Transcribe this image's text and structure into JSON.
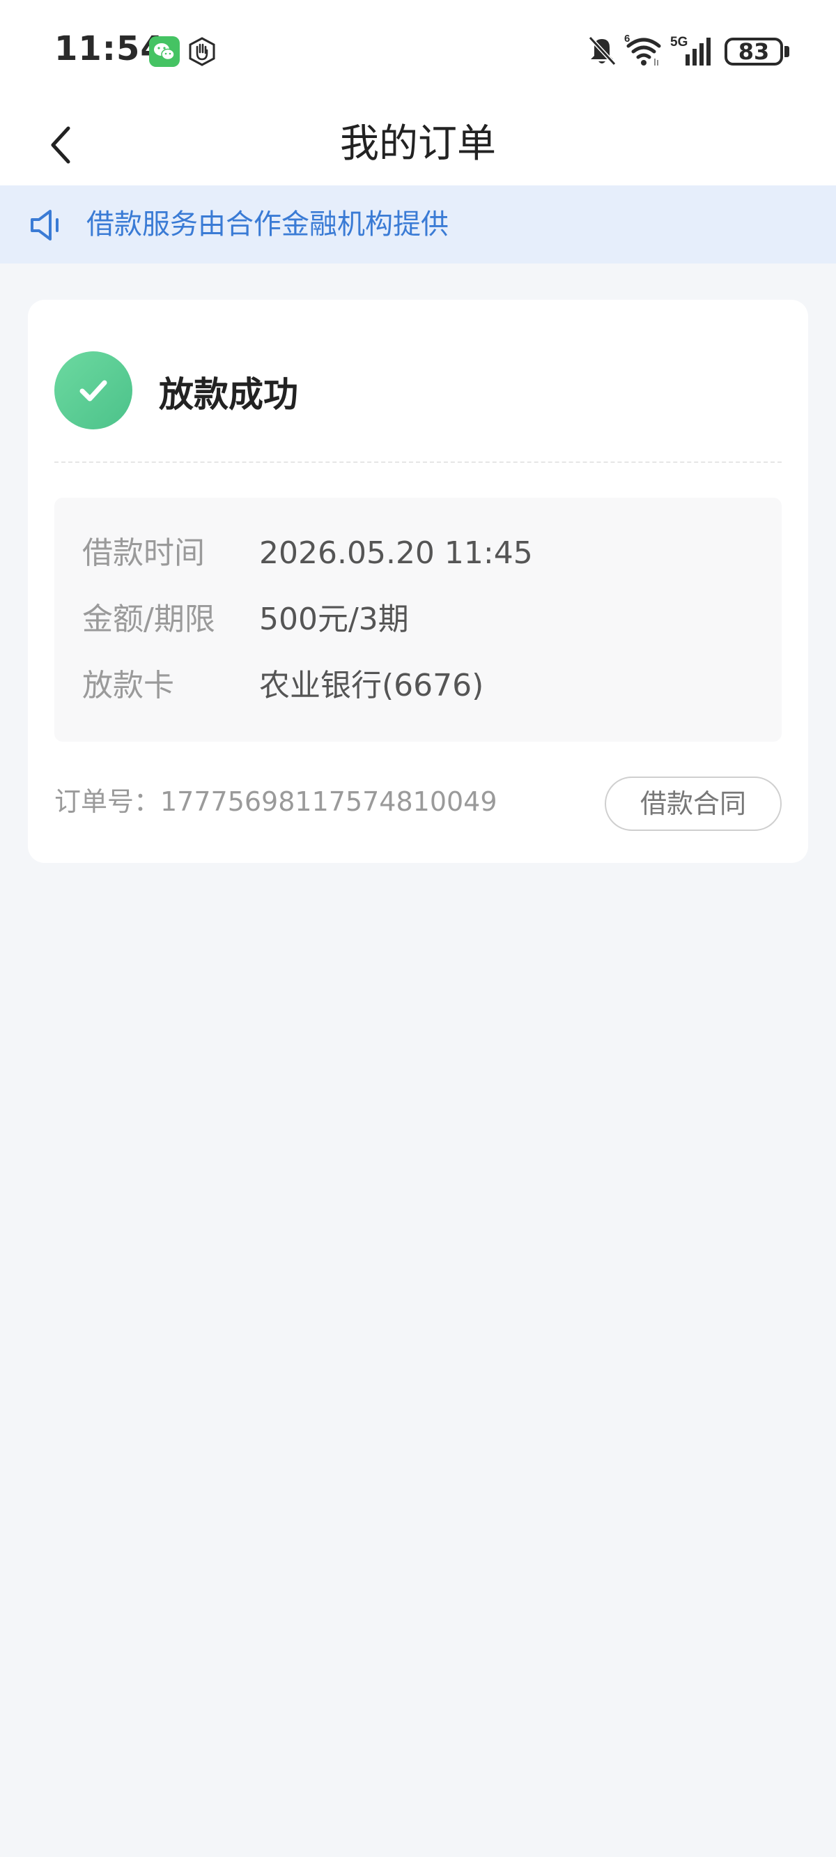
{
  "status_bar": {
    "time": "11:54",
    "battery": "83",
    "signal_label": "5G",
    "wifi_label": "6",
    "icons": [
      "wechat-icon",
      "hand-icon",
      "mute-icon",
      "wifi-icon",
      "signal-icon",
      "battery-icon"
    ]
  },
  "nav": {
    "title": "我的订单",
    "back_icon": "chevron-left-icon"
  },
  "notice": {
    "icon": "speaker-icon",
    "text": "借款服务由合作金融机构提供",
    "color": "#3a7bd5",
    "background": "#e6eefb"
  },
  "order": {
    "status_text": "放款成功",
    "status_icon": "check-circle-icon",
    "status_color": "#4cc28a",
    "details": [
      {
        "label": "借款时间",
        "value": "2026.05.20 11:45"
      },
      {
        "label": "金额/期限",
        "value": "500元/3期"
      },
      {
        "label": "放款卡",
        "value": "农业银行(6676)"
      }
    ],
    "order_number_label": "订单号：",
    "order_number": "17775698117574810049",
    "order_number_text": "订单号：17775698117574810049",
    "contract_button": "借款合同"
  }
}
